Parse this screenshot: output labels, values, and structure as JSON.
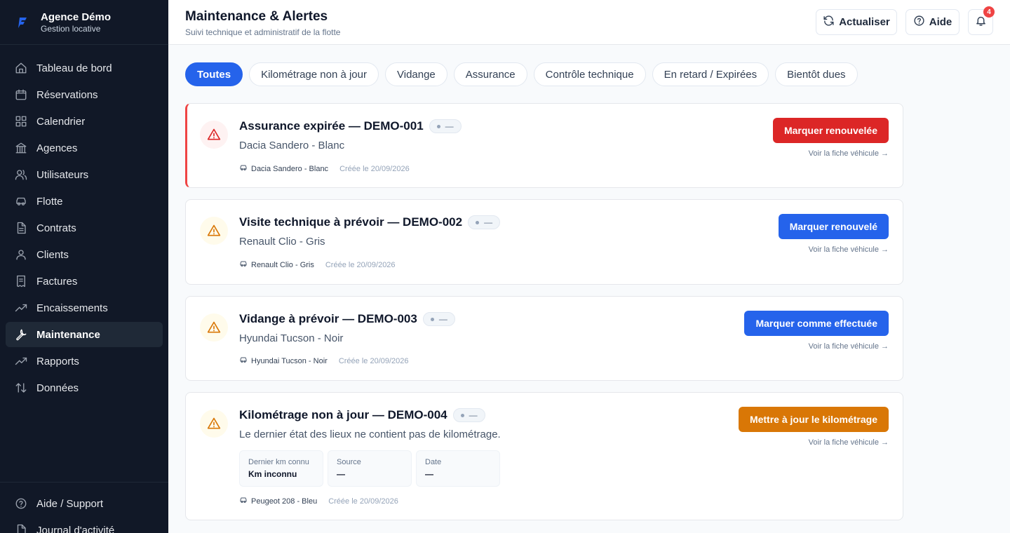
{
  "brand": {
    "name": "Agence Démo",
    "sub": "Gestion locative",
    "accent": "#2563eb"
  },
  "sidebar": {
    "items": [
      {
        "label": "Tableau de bord",
        "icon": "home-icon"
      },
      {
        "label": "Réservations",
        "icon": "calendar-icon"
      },
      {
        "label": "Calendrier",
        "icon": "grid-icon"
      },
      {
        "label": "Agences",
        "icon": "building-icon"
      },
      {
        "label": "Utilisateurs",
        "icon": "users-icon"
      },
      {
        "label": "Flotte",
        "icon": "car-icon"
      },
      {
        "label": "Contrats",
        "icon": "file-icon"
      },
      {
        "label": "Clients",
        "icon": "user-icon"
      },
      {
        "label": "Factures",
        "icon": "receipt-icon"
      },
      {
        "label": "Encaissements",
        "icon": "trending-icon"
      },
      {
        "label": "Maintenance",
        "icon": "wrench-icon",
        "active": true
      },
      {
        "label": "Rapports",
        "icon": "chart-icon"
      },
      {
        "label": "Données",
        "icon": "sort-icon"
      }
    ],
    "bottom": [
      {
        "label": "Aide / Support",
        "icon": "help-icon"
      },
      {
        "label": "Journal d'activité",
        "icon": "log-icon"
      }
    ]
  },
  "header": {
    "title": "Maintenance & Alertes",
    "subtitle": "Suivi technique et administratif de la flotte",
    "refresh_label": "Actualiser",
    "help_label": "Aide",
    "notifications_count": "4"
  },
  "filters": [
    "Toutes",
    "Kilométrage non à jour",
    "Vidange",
    "Assurance",
    "Contrôle technique",
    "En retard / Expirées",
    "Bientôt dues"
  ],
  "cards": [
    {
      "title": "Assurance expirée — DEMO-001",
      "pill": "—",
      "subtitle": "Dacia Sandero - Blanc",
      "vehicle": "Dacia Sandero - Blanc",
      "created": "Créée le 20/09/2026",
      "action": "Marquer renouvelée",
      "action_color": "#dc2626",
      "link": "Voir la fiche véhicule →"
    },
    {
      "title": "Visite technique à prévoir — DEMO-002",
      "pill": "—",
      "subtitle": "Renault Clio - Gris",
      "vehicle": "Renault Clio - Gris",
      "created": "Créée le 20/09/2026",
      "action": "Marquer renouvelé",
      "action_color": "#2563eb",
      "link": "Voir la fiche véhicule →"
    },
    {
      "title": "Vidange à prévoir — DEMO-003",
      "pill": "—",
      "subtitle": "Hyundai Tucson - Noir",
      "vehicle": "Hyundai Tucson - Noir",
      "created": "Créée le 20/09/2026",
      "action": "Marquer comme effectuée",
      "action_color": "#2563eb",
      "link": "Voir la fiche véhicule →"
    },
    {
      "title": "Kilométrage non à jour — DEMO-004",
      "pill": "—",
      "subtitle": "Le dernier état des lieux ne contient pas de kilométrage.",
      "stats": [
        {
          "label": "Dernier km connu",
          "value": "Km inconnu"
        },
        {
          "label": "Source",
          "value": "—"
        },
        {
          "label": "Date",
          "value": "—"
        }
      ],
      "vehicle": "Peugeot 208 - Bleu",
      "created": "Créée le 20/09/2026",
      "action": "Mettre à jour le kilométrage",
      "action_color": "#d97706",
      "link": "Voir la fiche véhicule →"
    }
  ]
}
